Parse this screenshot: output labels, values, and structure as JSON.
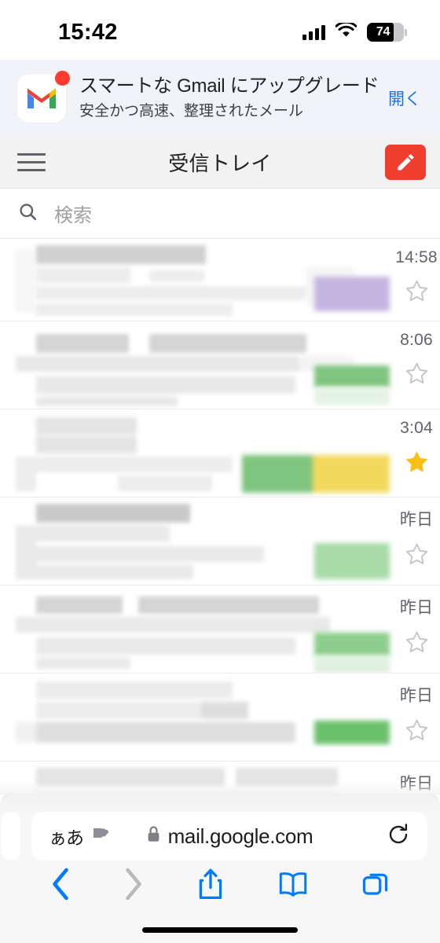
{
  "status_bar": {
    "time": "15:42",
    "cellular_icon": "cellular-signal-icon",
    "wifi_icon": "wifi-icon",
    "battery_percent": "74",
    "battery_level": 74
  },
  "app_banner": {
    "app_icon": "gmail-logo-icon",
    "badge": "notification-badge",
    "title": "スマートな Gmail にアップグレード",
    "subtitle": "安全かつ高速、整理されたメール",
    "open_label": "開く",
    "link_color": "#1a73e8",
    "background": "#f1f3f8"
  },
  "gmail_toolbar": {
    "menu_icon": "hamburger-menu-icon",
    "title": "受信トレイ",
    "compose_icon": "compose-pencil-icon",
    "compose_color": "#f03e2f",
    "background": "#f2f2f2"
  },
  "search": {
    "icon": "search-icon",
    "placeholder": "検索",
    "value": ""
  },
  "mail_list": {
    "redacted": true,
    "rows": [
      {
        "time": "14:58",
        "starred": false,
        "star_icon": "star-outline-icon",
        "labels": [
          "#c4b5e0"
        ]
      },
      {
        "time": "8:06",
        "starred": false,
        "star_icon": "star-outline-icon",
        "labels": [
          "#7fc47f"
        ]
      },
      {
        "time": "3:04",
        "starred": true,
        "star_icon": "star-filled-icon",
        "labels": [
          "#7fc47f",
          "#f2d95e"
        ]
      },
      {
        "time": "昨日",
        "starred": false,
        "star_icon": "star-outline-icon",
        "labels": [
          "#a8dba8"
        ]
      },
      {
        "time": "昨日",
        "starred": false,
        "star_icon": "star-outline-icon",
        "labels": [
          "#8dcd8d"
        ]
      },
      {
        "time": "昨日",
        "starred": false,
        "star_icon": "star-outline-icon",
        "labels": [
          "#6cc16c"
        ]
      },
      {
        "time": "昨日",
        "starred": false,
        "star_icon": "star-outline-icon",
        "labels": []
      }
    ],
    "star_filled_color": "#f9bf17",
    "star_outline_color": "#c8c8c8"
  },
  "safari": {
    "text_size_label": "ぁあ",
    "extension_icon": "puzzle-extension-icon",
    "lock_icon": "lock-icon",
    "url": "mail.google.com",
    "reload_icon": "reload-icon",
    "nav": [
      {
        "name": "back",
        "icon": "chevron-left-icon",
        "enabled": true,
        "color": "#007aff"
      },
      {
        "name": "forward",
        "icon": "chevron-right-icon",
        "enabled": false,
        "color": "#b8b8bd"
      },
      {
        "name": "share",
        "icon": "share-icon",
        "enabled": true,
        "color": "#007aff"
      },
      {
        "name": "bookmarks",
        "icon": "book-icon",
        "enabled": true,
        "color": "#007aff"
      },
      {
        "name": "tabs",
        "icon": "tabs-icon",
        "enabled": true,
        "color": "#007aff"
      }
    ],
    "home_indicator": "home-indicator"
  }
}
